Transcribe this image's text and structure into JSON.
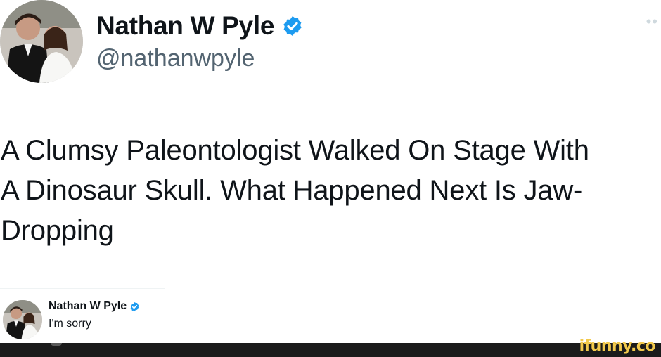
{
  "author": {
    "display_name": "Nathan W Pyle",
    "handle": "@nathanwpyle",
    "avatar_icon": "wedding-photo-avatar",
    "verified_icon": "verified-badge-icon",
    "verified_color": "#1d9bf0"
  },
  "tweet": {
    "text_lines": [
      "A Clumsy Paleontologist Walked On Stage With",
      "A Dinosaur Skull. What Happened Next Is Jaw-",
      "Dropping"
    ]
  },
  "reply": {
    "display_name": "Nathan W Pyle",
    "text": "I'm sorry"
  },
  "more_icon": "••",
  "watermark": {
    "text": "ifunny.co",
    "color": "#f2c94c"
  }
}
